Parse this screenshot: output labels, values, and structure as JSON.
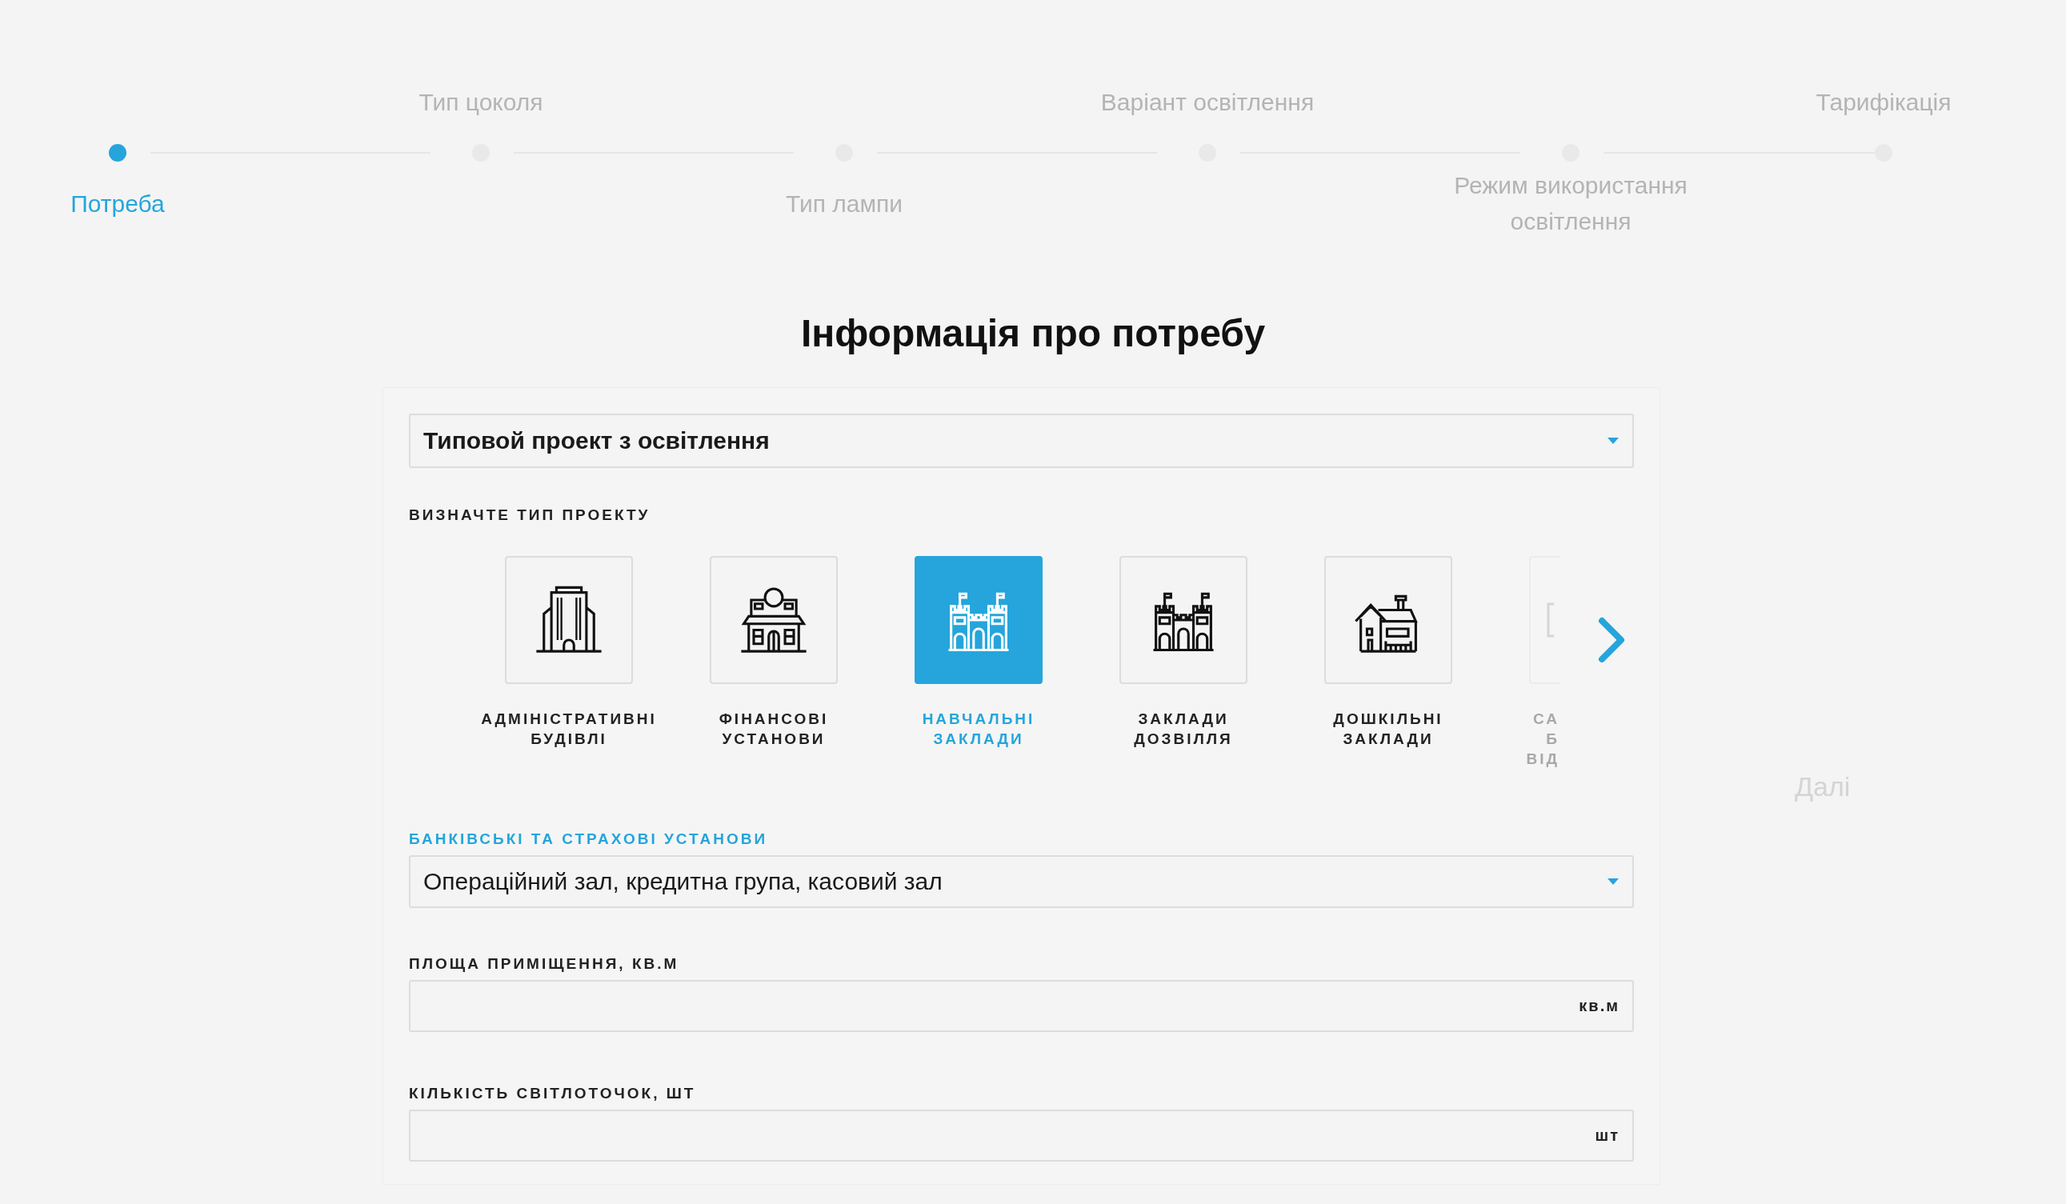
{
  "steps": [
    {
      "label": "Потреба",
      "selected": true
    },
    {
      "label": "Тип цоколя",
      "selected": false
    },
    {
      "label": "Тип лампи",
      "selected": false
    },
    {
      "label": "Варіант освітлення",
      "selected": false
    },
    {
      "label": "Режим використання освітлення",
      "selected": false
    },
    {
      "label": "Тарифікація",
      "selected": false
    }
  ],
  "title": "Інформація про потребу",
  "project_select": {
    "value": "Типовой проект з освітлення"
  },
  "project_type": {
    "label": "ВИЗНАЧТЕ ТИП ПРОЕКТУ",
    "cards": [
      {
        "kind": "full",
        "lines": [
          "АДМІНІСТРАТИВНІ",
          "БУДІВЛІ"
        ],
        "selected": false
      },
      {
        "kind": "full",
        "lines": [
          "ФІНАНСОВІ",
          "УСТАНОВИ"
        ],
        "selected": false
      },
      {
        "kind": "full",
        "lines": [
          "НАВЧАЛЬНІ",
          "ЗАКЛАДИ"
        ],
        "selected": true
      },
      {
        "kind": "full",
        "lines": [
          "ЗАКЛАДИ",
          "ДОЗВІЛЛЯ"
        ],
        "selected": false
      },
      {
        "kind": "full",
        "lines": [
          "ДОШКІЛЬНІ",
          "ЗАКЛАДИ"
        ],
        "selected": false
      },
      {
        "kind": "partial",
        "lines": [
          "СА",
          "Б",
          "ВІД"
        ],
        "selected": false
      }
    ]
  },
  "category_select": {
    "label": "БАНКІВСЬКІ ТА СТРАХОВІ УСТАНОВИ",
    "value": "Операційний зал, кредитна група, касовий зал"
  },
  "fields": [
    {
      "label": "ПЛОЩА ПРИМІЩЕННЯ, КВ.М",
      "unit": "кв.м"
    },
    {
      "label": "КІЛЬКІСТЬ СВІТЛОТОЧОК, ШТ",
      "unit": "шт"
    }
  ],
  "next_button": "Далі"
}
